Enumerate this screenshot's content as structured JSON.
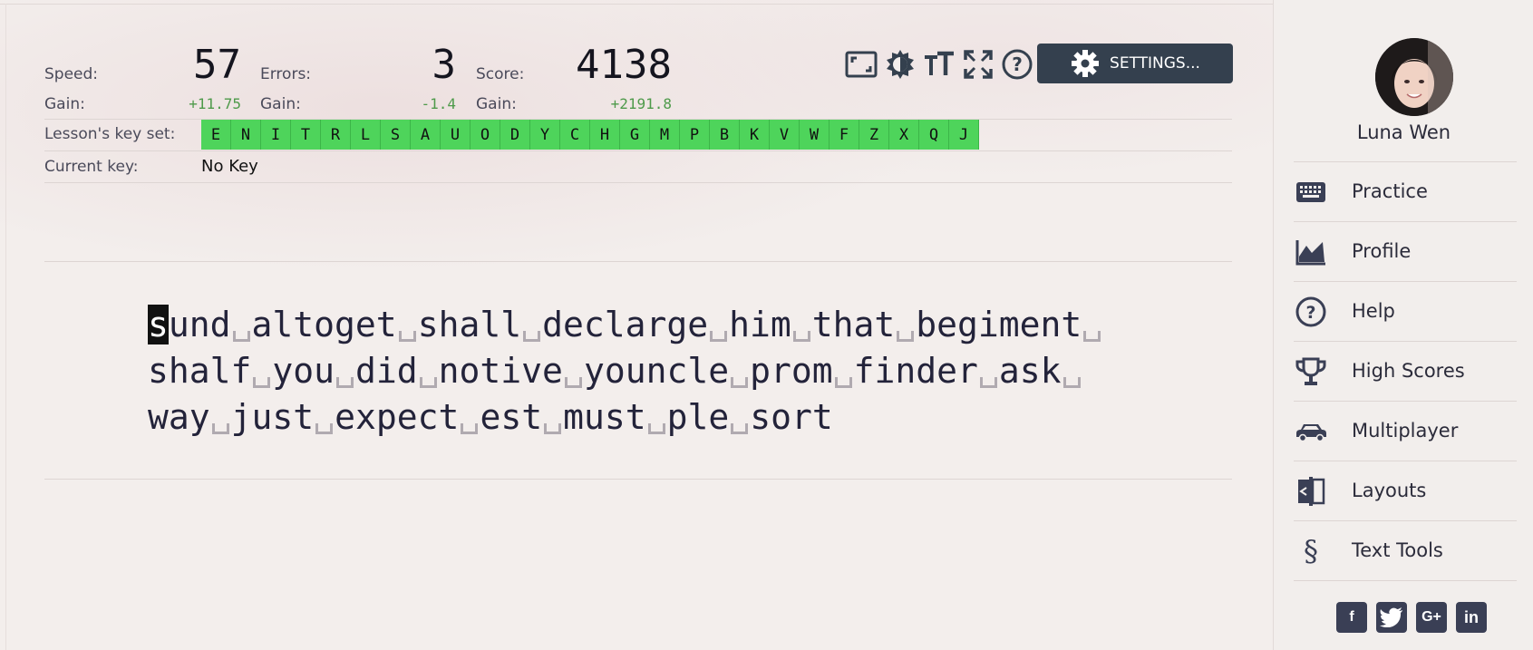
{
  "stats": {
    "speed": {
      "label": "Speed:",
      "value": "57",
      "gain_label": "Gain:",
      "gain": "+11.75"
    },
    "errors": {
      "label": "Errors:",
      "value": "3",
      "gain_label": "Gain:",
      "gain": "-1.4"
    },
    "score": {
      "label": "Score:",
      "value": "4138",
      "gain_label": "Gain:",
      "gain": "+2191.8"
    }
  },
  "keyset": {
    "label": "Lesson's key set:",
    "keys": [
      "E",
      "N",
      "I",
      "T",
      "R",
      "L",
      "S",
      "A",
      "U",
      "O",
      "D",
      "Y",
      "C",
      "H",
      "G",
      "M",
      "P",
      "B",
      "K",
      "V",
      "W",
      "F",
      "Z",
      "X",
      "Q",
      "J"
    ]
  },
  "current_key": {
    "label": "Current key:",
    "value": "No Key"
  },
  "toolbar": {
    "icons": [
      "fullscreen-window-icon",
      "theme-contrast-icon",
      "font-size-icon",
      "expand-icon",
      "help-circle-icon"
    ],
    "settings_label": "SETTINGS..."
  },
  "typing": {
    "cursor_char": "s",
    "lines": [
      [
        "und",
        "altoget",
        "shall",
        "declarge",
        "him",
        "that",
        "begiment",
        ""
      ],
      [
        "shalf",
        "you",
        "did",
        "notive",
        "youncle",
        "prom",
        "finder",
        "ask",
        ""
      ],
      [
        "way",
        "just",
        "expect",
        "est",
        "must",
        "ple",
        "sort"
      ]
    ]
  },
  "sidebar": {
    "user_name": "Luna Wen",
    "nav": [
      {
        "label": "Practice",
        "icon": "keyboard-icon"
      },
      {
        "label": "Profile",
        "icon": "chart-line-icon"
      },
      {
        "label": "Help",
        "icon": "help-icon"
      },
      {
        "label": "High Scores",
        "icon": "trophy-icon"
      },
      {
        "label": "Multiplayer",
        "icon": "car-icon"
      },
      {
        "label": "Layouts",
        "icon": "layouts-icon"
      },
      {
        "label": "Text Tools",
        "icon": "section-icon"
      }
    ],
    "social": [
      "facebook-icon",
      "twitter-icon",
      "google-plus-icon",
      "linkedin-icon"
    ]
  },
  "colors": {
    "keyset_green": "#4ed45b",
    "gain_green": "#4e9a4a",
    "settings_bg": "#34404e"
  }
}
